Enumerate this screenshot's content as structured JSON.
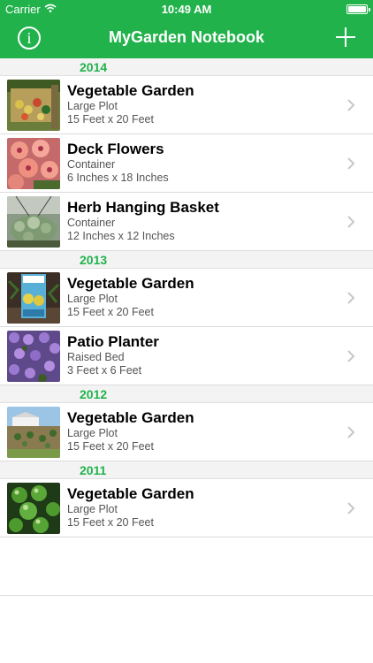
{
  "status_bar": {
    "carrier": "Carrier",
    "time": "10:49 AM"
  },
  "nav": {
    "title": "MyGarden Notebook",
    "info_icon": "info-icon",
    "add_icon": "plus-icon"
  },
  "sections": [
    {
      "year": "2014"
    },
    {
      "year": "2013"
    },
    {
      "year": "2012"
    },
    {
      "year": "2011"
    }
  ],
  "gardens": [
    {
      "title": "Vegetable Garden",
      "type": "Large Plot",
      "size": "15 Feet x 20 Feet",
      "photo": "vegetable harvest"
    },
    {
      "title": "Deck Flowers",
      "type": "Container",
      "size": "6 Inches x 18 Inches",
      "photo": "pink flowers"
    },
    {
      "title": "Herb Hanging Basket",
      "type": "Container",
      "size": "12 Inches x 12 Inches",
      "photo": "hanging herbs"
    },
    {
      "title": "Vegetable Garden",
      "type": "Large Plot",
      "size": "15 Feet x 20 Feet",
      "photo": "seed packet"
    },
    {
      "title": "Patio Planter",
      "type": "Raised Bed",
      "size": "3 Feet x 6 Feet",
      "photo": "purple flowers"
    },
    {
      "title": "Vegetable Garden",
      "type": "Large Plot",
      "size": "15 Feet x 20 Feet",
      "photo": "garden plot"
    },
    {
      "title": "Vegetable Garden",
      "type": "Large Plot",
      "size": "15 Feet x 20 Feet",
      "photo": "green tomatoes"
    }
  ],
  "colors": {
    "accent": "#21b24b",
    "section_bg": "#f3f3f3",
    "chevron": "#c7c7cc"
  }
}
